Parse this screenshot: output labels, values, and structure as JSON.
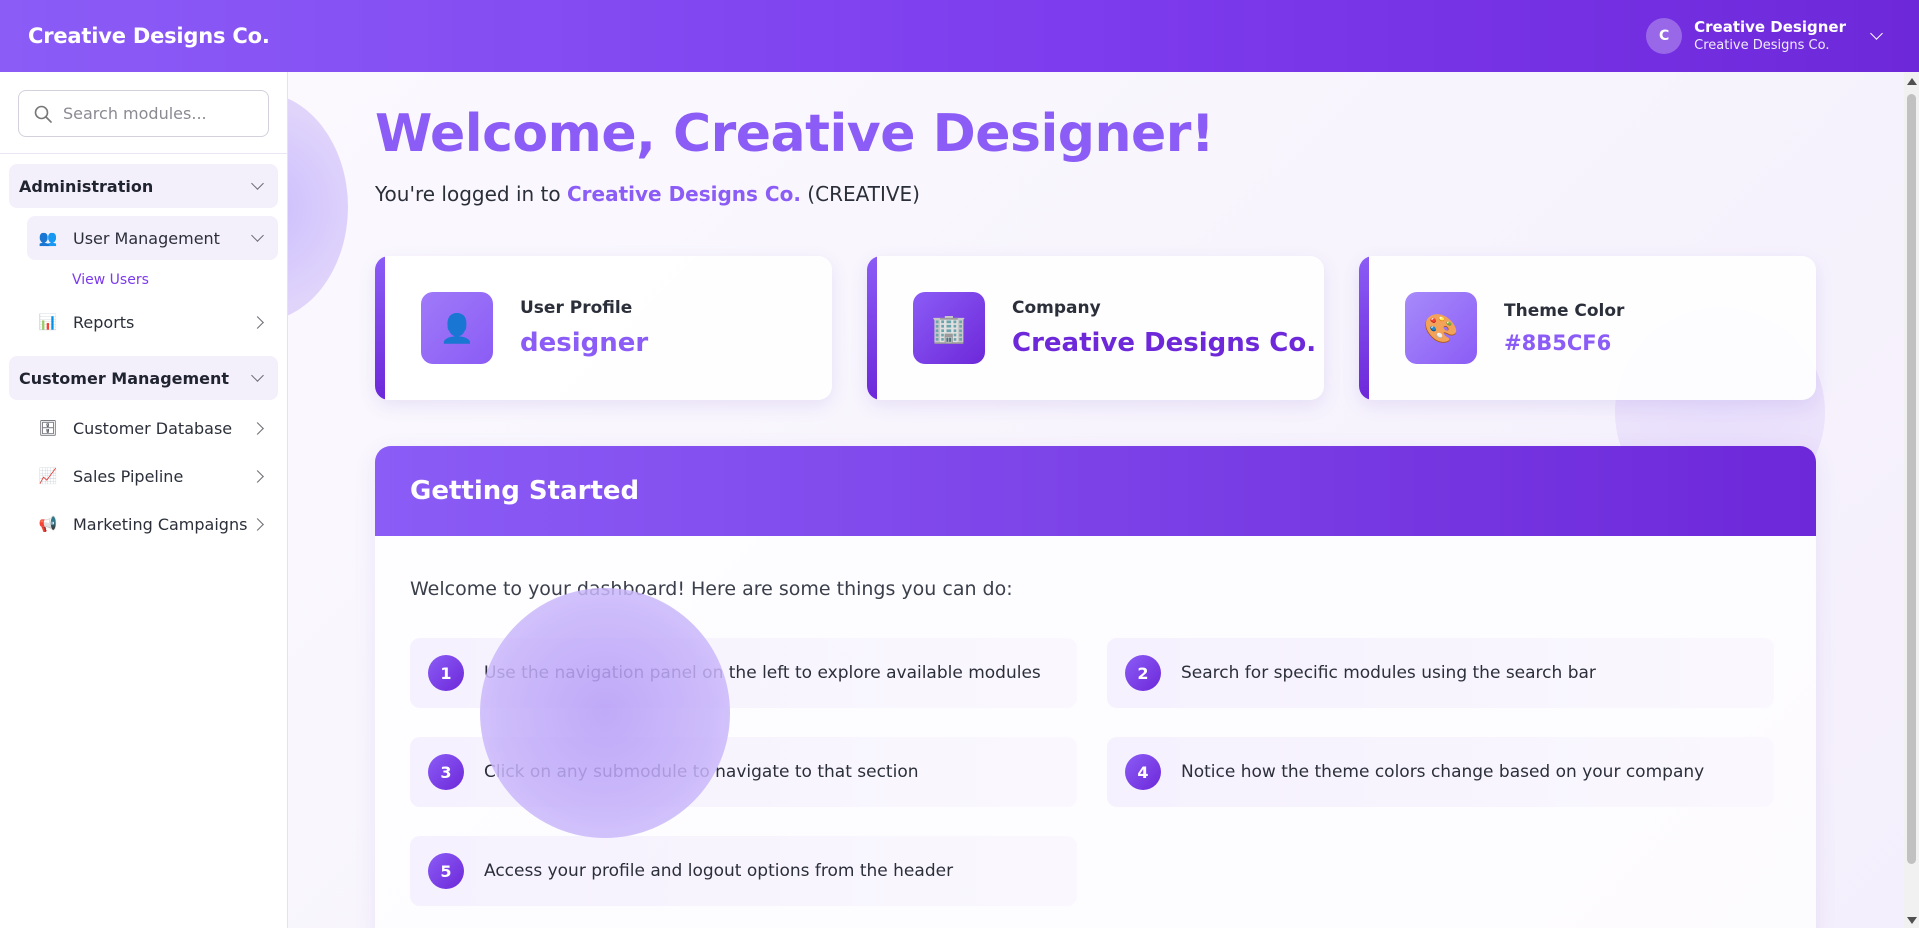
{
  "header": {
    "brand": "Creative Designs Co.",
    "user_initial": "C",
    "user_name": "Creative Designer",
    "user_company": "Creative Designs Co."
  },
  "sidebar": {
    "search_placeholder": "Search modules...",
    "sections": [
      {
        "title": "Administration",
        "items": [
          {
            "label": "User Management",
            "icon": "users-icon",
            "glyph": "👥",
            "subitems": [
              "View Users"
            ]
          },
          {
            "label": "Reports",
            "icon": "bar-chart-icon",
            "glyph": "📊"
          }
        ]
      },
      {
        "title": "Customer Management",
        "items": [
          {
            "label": "Customer Database",
            "icon": "database-icon",
            "glyph": "🗄"
          },
          {
            "label": "Sales Pipeline",
            "icon": "trend-chart-icon",
            "glyph": "📈"
          },
          {
            "label": "Marketing Campaigns",
            "icon": "megaphone-icon",
            "glyph": "📢"
          }
        ]
      }
    ]
  },
  "main": {
    "welcome": "Welcome, Creative Designer!",
    "logged_prefix": "You're logged in to",
    "logged_company": "Creative Designs Co.",
    "logged_code": "(CREATIVE)",
    "cards": [
      {
        "label": "User Profile",
        "value": "designer",
        "icon": "user-icon",
        "glyph": "👤"
      },
      {
        "label": "Company",
        "value": "Creative Designs Co.",
        "icon": "building-icon",
        "glyph": "🏢"
      },
      {
        "label": "Theme Color",
        "value": "#8B5CF6",
        "icon": "palette-icon",
        "glyph": "🎨"
      }
    ],
    "getting_started": {
      "title": "Getting Started",
      "intro": "Welcome to your dashboard! Here are some things you can do:",
      "steps": [
        {
          "num": "1",
          "text": "Use the navigation panel on the left to explore available modules"
        },
        {
          "num": "2",
          "text": "Search for specific modules using the search bar"
        },
        {
          "num": "3",
          "text": "Click on any submodule to navigate to that section"
        },
        {
          "num": "4",
          "text": "Notice how the theme colors change based on your company"
        },
        {
          "num": "5",
          "text": "Access your profile and logout options from the header"
        }
      ]
    }
  },
  "colors": {
    "accent": "#8b5cf6",
    "accent_dark": "#6d28d9"
  }
}
